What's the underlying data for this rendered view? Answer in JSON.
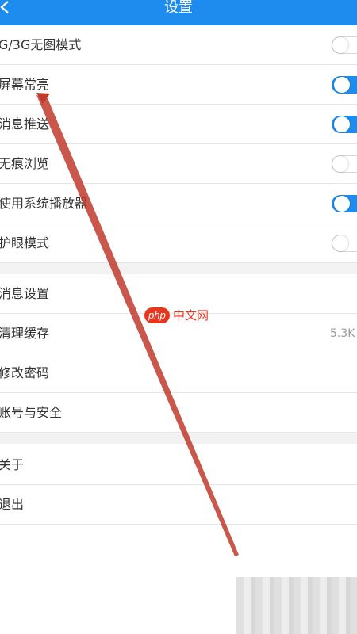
{
  "header": {
    "title": "设置",
    "back_icon": "chevron-left-icon",
    "background": "#1e8cef"
  },
  "settings_toggles": [
    {
      "label": "G/3G无图模式",
      "enabled": false
    },
    {
      "label": "屏幕常亮",
      "enabled": true
    },
    {
      "label": "消息推送",
      "enabled": true
    },
    {
      "label": "无痕浏览",
      "enabled": false
    },
    {
      "label": "使用系统播放器",
      "enabled": true
    },
    {
      "label": "护眼模式",
      "enabled": false
    }
  ],
  "account_items": [
    {
      "label": "消息设置",
      "value": ""
    },
    {
      "label": "清理缓存",
      "value": "5.3K"
    },
    {
      "label": "修改密码",
      "value": ""
    },
    {
      "label": "账号与安全",
      "value": ""
    }
  ],
  "about_items": [
    {
      "label": "关于"
    },
    {
      "label": "退出"
    }
  ],
  "watermark": {
    "badge": "php",
    "text": "中文网"
  },
  "colors": {
    "accent": "#1e8cef",
    "arrow": "#c0392b",
    "watermark": "#e8351f"
  }
}
